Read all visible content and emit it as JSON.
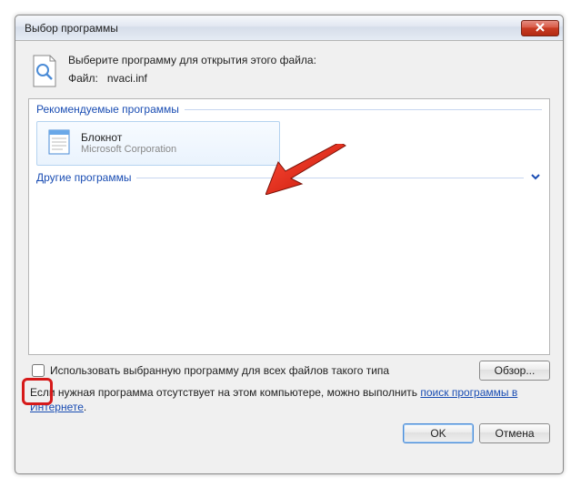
{
  "window": {
    "title": "Выбор программы"
  },
  "header": {
    "instruction": "Выберите программу для открытия этого файла:",
    "file_label": "Файл:",
    "file_name": "nvaci.inf"
  },
  "groups": {
    "recommended": "Рекомендуемые программы",
    "other": "Другие программы"
  },
  "programs": {
    "notepad": {
      "name": "Блокнот",
      "publisher": "Microsoft Corporation"
    }
  },
  "checkbox": {
    "label": "Использовать выбранную программу для всех файлов такого типа"
  },
  "note": {
    "prefix": "Если нужная программа отсутствует на этом компьютере, можно выполнить ",
    "link": "поиск программы в Интернете",
    "suffix": "."
  },
  "buttons": {
    "browse": "Обзор...",
    "ok": "OK",
    "cancel": "Отмена"
  }
}
